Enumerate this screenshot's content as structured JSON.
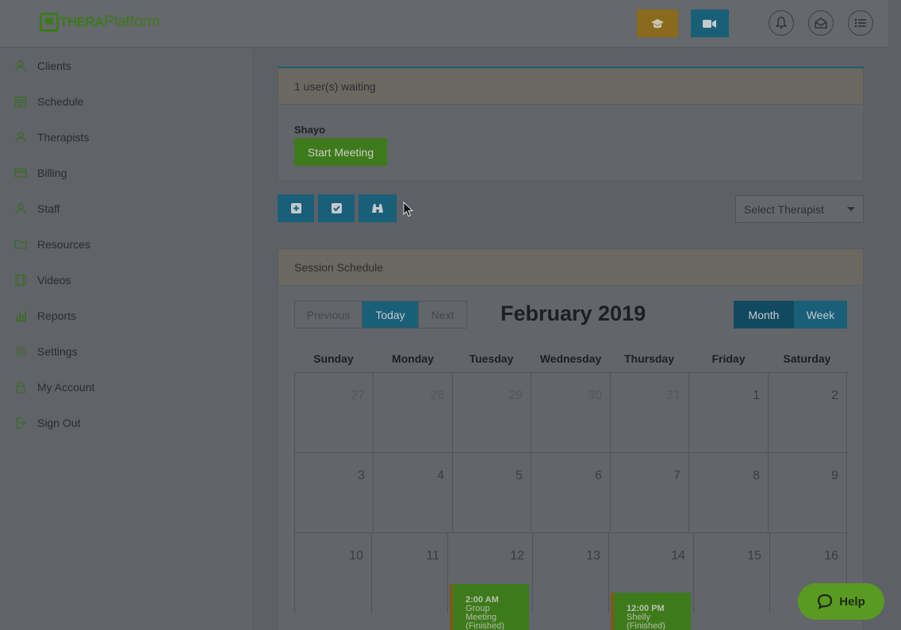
{
  "brand": {
    "logo_left": "THERA",
    "logo_right": "Platform"
  },
  "topbar": {
    "icons": [
      "graduation-cap-icon",
      "video-camera-icon",
      "bell-icon",
      "mail-icon",
      "list-icon"
    ]
  },
  "sidebar": {
    "items": [
      {
        "label": "Clients",
        "icon": "clients-icon"
      },
      {
        "label": "Schedule",
        "icon": "calendar-icon"
      },
      {
        "label": "Therapists",
        "icon": "therapists-icon"
      },
      {
        "label": "Billing",
        "icon": "credit-card-icon"
      },
      {
        "label": "Staff",
        "icon": "staff-icon"
      },
      {
        "label": "Resources",
        "icon": "folder-icon"
      },
      {
        "label": "Videos",
        "icon": "film-icon"
      },
      {
        "label": "Reports",
        "icon": "bar-chart-icon"
      },
      {
        "label": "Settings",
        "icon": "gear-icon"
      },
      {
        "label": "My Account",
        "icon": "lock-icon"
      },
      {
        "label": "Sign Out",
        "icon": "sign-out-icon"
      }
    ]
  },
  "waiting": {
    "header": "1 user(s) waiting",
    "user": "Shayo",
    "start_label": "Start Meeting"
  },
  "toolbar": {
    "buttons": [
      "plus-square-icon",
      "check-square-icon",
      "binoculars-icon"
    ]
  },
  "therapist_select": {
    "value": "Select Therapist"
  },
  "schedule": {
    "header": "Session Schedule",
    "prev": "Previous",
    "today": "Today",
    "next": "Next",
    "title": "February 2019",
    "month": "Month",
    "week": "Week",
    "days": [
      "Sunday",
      "Monday",
      "Tuesday",
      "Wednesday",
      "Thursday",
      "Friday",
      "Saturday"
    ],
    "weeks": [
      [
        "27",
        "28",
        "29",
        "30",
        "31",
        "1",
        "2"
      ],
      [
        "3",
        "4",
        "5",
        "6",
        "7",
        "8",
        "9"
      ],
      [
        "10",
        "11",
        "12",
        "13",
        "14",
        "15",
        "16"
      ]
    ],
    "events": [
      {
        "time": "2:00 AM",
        "line1": "Group",
        "line2": "Meeting",
        "line3": "(Finished)"
      },
      {
        "time": "12:00 PM",
        "line1": "Shelly",
        "line2": "(Finished)",
        "line3": ""
      }
    ]
  },
  "help": {
    "label": "Help"
  }
}
